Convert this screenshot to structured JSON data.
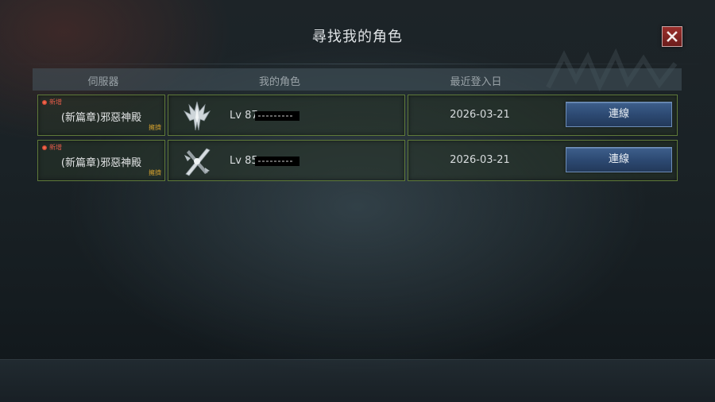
{
  "title": "尋找我的角色",
  "close_icon": "close-icon",
  "columns": {
    "server": "伺服器",
    "character": "我的角色",
    "last_login": "最近登入日"
  },
  "rows": [
    {
      "new_badge": "新增",
      "server": "(新篇章)邪惡神殿",
      "crowd_status": "擁擠",
      "class_icon": "crystal-crest-icon",
      "level": "Lv 87",
      "last_login": "2026-03-21",
      "connect_label": "連線"
    },
    {
      "new_badge": "新增",
      "server": "(新篇章)邪惡神殿",
      "crowd_status": "擁擠",
      "class_icon": "crossed-blades-icon",
      "level": "Lv 85",
      "last_login": "2026-03-21",
      "connect_label": "連線"
    }
  ],
  "colors": {
    "cell_border": "#5f7a3a",
    "connect_button": "#2d4a73",
    "new_badge": "#e05a48",
    "crowd_tag": "#d4a12e",
    "close_button": "#8a2a28"
  }
}
